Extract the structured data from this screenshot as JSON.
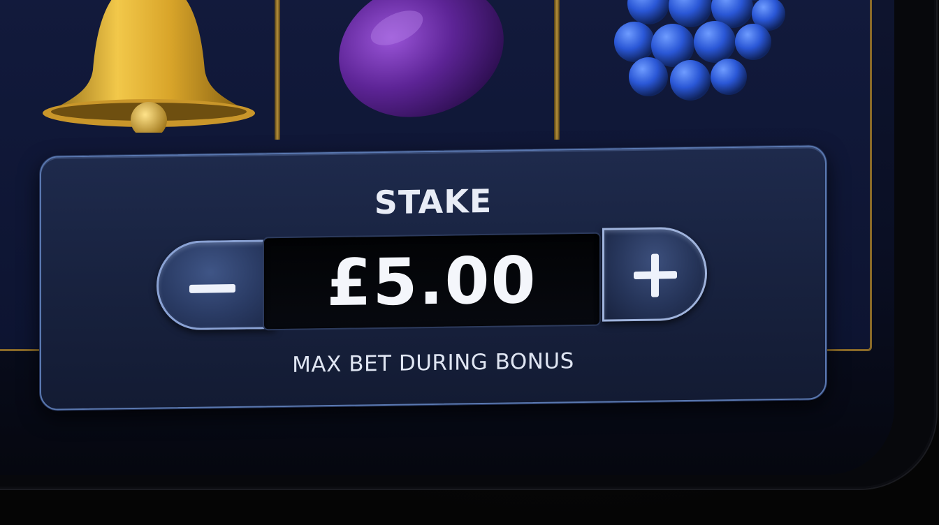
{
  "game": {
    "reel_symbols": [
      {
        "name": "bell",
        "icon": "bell-icon"
      },
      {
        "name": "plum",
        "icon": "plum-icon"
      },
      {
        "name": "grapes",
        "icon": "grapes-icon"
      }
    ]
  },
  "stake_panel": {
    "title": "STAKE",
    "value": "£5.00",
    "decrease_icon": "minus-icon",
    "increase_icon": "plus-icon",
    "note": "MAX BET DURING BONUS"
  },
  "colors": {
    "panel_background": "#1b2646",
    "panel_border": "#5a78b0",
    "button_fill": "#2a3b64",
    "value_background": "#04060b",
    "text": "#eef2fb",
    "reel_frame_gold": "#b8923a"
  }
}
